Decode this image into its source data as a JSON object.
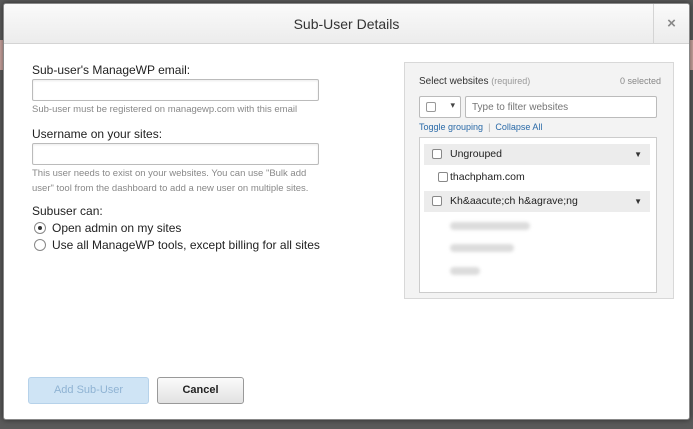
{
  "dialog": {
    "title": "Sub-User Details",
    "close_glyph": "×"
  },
  "form": {
    "email_label": "Sub-user's ManageWP email:",
    "email_value": "",
    "email_hint": "Sub-user must be registered on managewp.com with this email",
    "username_label": "Username on your sites:",
    "username_value": "",
    "username_hint_1": "This user needs to exist on your websites. You can use \"Bulk add",
    "username_hint_2": "user\" tool from the dashboard to add a new user on multiple sites.",
    "subuser_can_label": "Subuser can:",
    "options": [
      {
        "label": "Open admin on my sites",
        "checked": true
      },
      {
        "label": "Use all ManageWP tools, except billing for all sites",
        "checked": false
      }
    ]
  },
  "websites": {
    "title": "Select websites",
    "required": "(required)",
    "selected_count": "0 selected",
    "filter_placeholder": "Type to filter websites",
    "toggle_grouping": "Toggle grouping",
    "collapse_all": "Collapse All",
    "groups": [
      {
        "name": "Ungrouped",
        "sites": [
          "thachpham.com"
        ]
      },
      {
        "name": "Kh&aacute;ch h&agrave;ng",
        "sites": []
      }
    ]
  },
  "buttons": {
    "add": "Add Sub-User",
    "cancel": "Cancel"
  },
  "icons": {
    "select_caret": "▾",
    "group_arrow": "▼"
  }
}
